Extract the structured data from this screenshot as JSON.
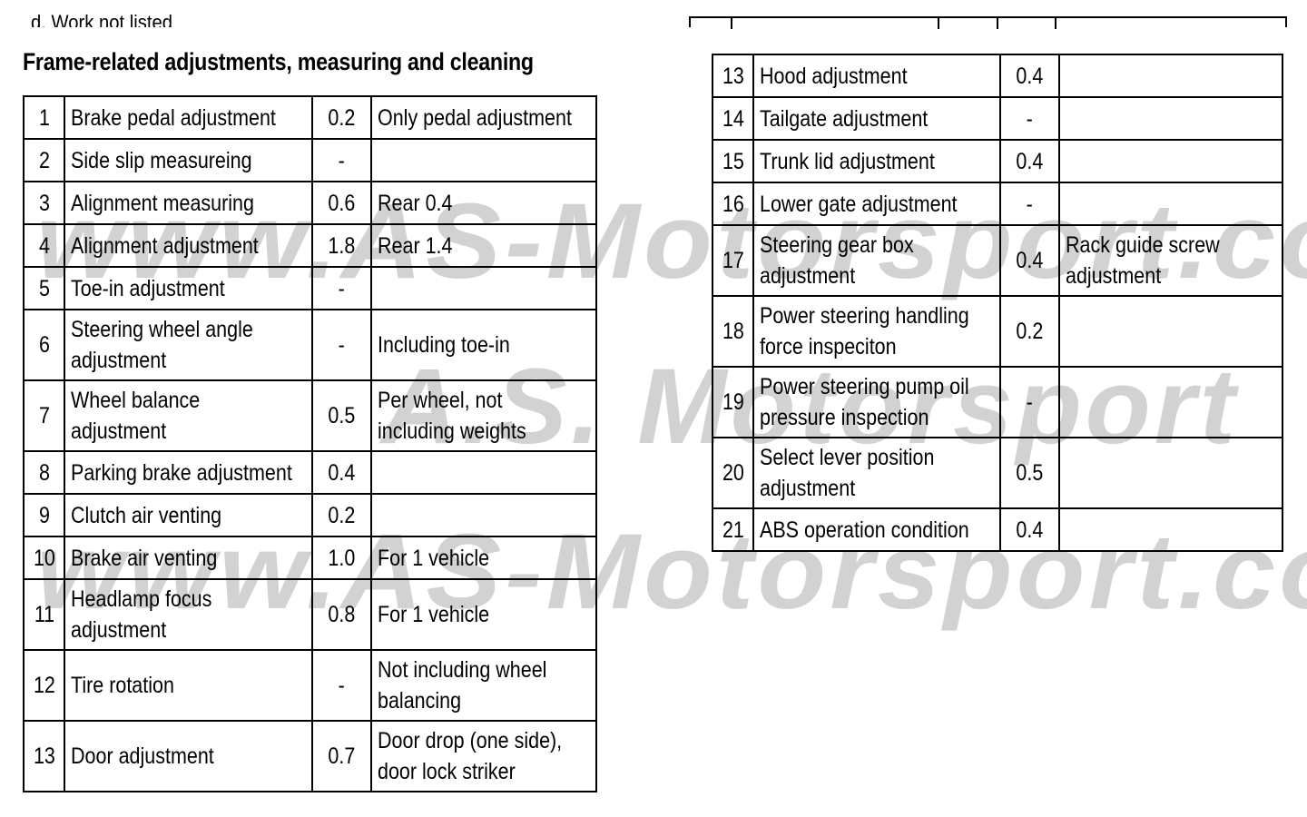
{
  "page": {
    "previous_heading": "d. Work not listed",
    "section_title": "Frame-related adjustments, measuring and cleaning",
    "watermark": {
      "line1": "www.AS-Motorsport.com",
      "line2": "A.S. Motorsport",
      "line3": "www.AS-Motorsport.com"
    }
  },
  "table_left": {
    "rows": [
      {
        "no": "1",
        "work": [
          "Brake pedal adjustment"
        ],
        "hours": "0.2",
        "note": [
          "Only pedal adjustment"
        ]
      },
      {
        "no": "2",
        "work": [
          "Side slip measureing"
        ],
        "hours": "-",
        "note": []
      },
      {
        "no": "3",
        "work": [
          "Alignment measuring"
        ],
        "hours": "0.6",
        "note": [
          "Rear  0.4"
        ]
      },
      {
        "no": "4",
        "work": [
          "Alignment adjustment"
        ],
        "hours": "1.8",
        "note": [
          "Rear  1.4"
        ]
      },
      {
        "no": "5",
        "work": [
          "Toe-in adjustment"
        ],
        "hours": "-",
        "note": []
      },
      {
        "no": "6",
        "work": [
          "Steering wheel angle",
          "adjustment"
        ],
        "hours": "-",
        "note": [
          "Including toe-in"
        ]
      },
      {
        "no": "7",
        "work": [
          "Wheel balance",
          "adjustment"
        ],
        "hours": "0.5",
        "note": [
          "Per wheel, not",
          "including weights"
        ]
      },
      {
        "no": "8",
        "work": [
          "Parking brake adjustment"
        ],
        "hours": "0.4",
        "note": []
      },
      {
        "no": "9",
        "work": [
          "Clutch air venting"
        ],
        "hours": "0.2",
        "note": []
      },
      {
        "no": "10",
        "work": [
          "Brake air venting"
        ],
        "hours": "1.0",
        "note": [
          "For 1 vehicle"
        ]
      },
      {
        "no": "11",
        "work": [
          "Headlamp focus",
          "adjustment"
        ],
        "hours": "0.8",
        "note": [
          "For 1 vehicle"
        ]
      },
      {
        "no": "12",
        "work": [
          "Tire rotation"
        ],
        "hours": "-",
        "note": [
          "Not including wheel",
          "balancing"
        ]
      },
      {
        "no": "13",
        "work": [
          "Door adjustment"
        ],
        "hours": "0.7",
        "note": [
          "Door drop (one side),",
          "door lock striker"
        ]
      }
    ]
  },
  "table_right": {
    "rows": [
      {
        "no": "13",
        "work": [
          "Hood adjustment"
        ],
        "hours": "0.4",
        "note": []
      },
      {
        "no": "14",
        "work": [
          "Tailgate adjustment"
        ],
        "hours": "-",
        "note": []
      },
      {
        "no": "15",
        "work": [
          "Trunk lid adjustment"
        ],
        "hours": "0.4",
        "note": []
      },
      {
        "no": "16",
        "work": [
          "Lower gate adjustment"
        ],
        "hours": "-",
        "note": []
      },
      {
        "no": "17",
        "work": [
          "Steering gear box",
          "adjustment"
        ],
        "hours": "0.4",
        "note": [
          "Rack guide screw",
          "adjustment"
        ]
      },
      {
        "no": "18",
        "work": [
          "Power steering handling",
          "force inspeciton"
        ],
        "hours": "0.2",
        "note": []
      },
      {
        "no": "19",
        "work": [
          "Power steering pump oil",
          "pressure inspection"
        ],
        "hours": "-",
        "note": []
      },
      {
        "no": "20",
        "work": [
          "Select lever position",
          "adjustment"
        ],
        "hours": "0.5",
        "note": []
      },
      {
        "no": "21",
        "work": [
          "ABS operation condition"
        ],
        "hours": "0.4",
        "note": []
      }
    ]
  }
}
